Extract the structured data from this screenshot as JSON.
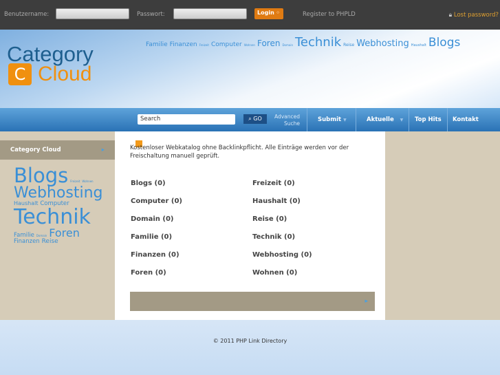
{
  "topbar": {
    "username_label": "Benutzername:",
    "password_label": "Passwort:",
    "login": "Login",
    "register": "Register to PHPLD",
    "lost": "Lost password?"
  },
  "logo": {
    "line1": "Category",
    "line2": "Cloud"
  },
  "header_cloud": [
    "Familie",
    "Finanzen",
    "Freizeit",
    "Computer",
    "Wohnen",
    "Foren",
    "Domain",
    "Technik",
    "Reise",
    "Webhosting",
    "Haushalt",
    "Blogs"
  ],
  "nav": {
    "search_placeholder": "Search",
    "go": "GO",
    "advanced1": "Advanced",
    "advanced2": "Suche",
    "submit": "Submit",
    "aktuelle": "Aktuelle",
    "tophits": "Top Hits",
    "kontakt": "Kontakt"
  },
  "sidebar": {
    "title": "Category Cloud",
    "cloud": [
      "Blogs",
      "Freizeit",
      "Wohnen",
      "Webhosting",
      "Haushalt",
      "Computer",
      "Technik",
      "Familie",
      "Domain",
      "Foren",
      "Finanzen",
      "Reise"
    ]
  },
  "main": {
    "intro": "Kostenloser Webkatalog ohne Backlinkpflicht. Alle Einträge werden vor der Freischaltung manuell geprüft.",
    "categories": [
      "Blogs (0)",
      "Freizeit (0)",
      "Computer (0)",
      "Haushalt (0)",
      "Domain (0)",
      "Reise (0)",
      "Familie (0)",
      "Technik (0)",
      "Finanzen (0)",
      "Webhosting (0)",
      "Foren (0)",
      "Wohnen (0)"
    ]
  },
  "footer": "© 2011 PHP Link Directory"
}
